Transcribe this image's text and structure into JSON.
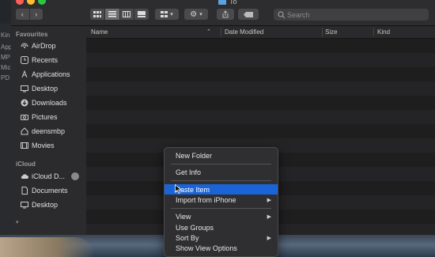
{
  "desktop": {
    "left_labels": [
      "Kin",
      "App",
      "MP",
      "Mic",
      "PD"
    ]
  },
  "window": {
    "title": "To",
    "search": {
      "placeholder": "Search"
    }
  },
  "sidebar": {
    "favourites_header": "Favourites",
    "favourites": [
      {
        "label": "AirDrop",
        "icon": "airdrop-icon"
      },
      {
        "label": "Recents",
        "icon": "clock-icon"
      },
      {
        "label": "Applications",
        "icon": "applications-icon"
      },
      {
        "label": "Desktop",
        "icon": "desktop-icon"
      },
      {
        "label": "Downloads",
        "icon": "download-icon"
      },
      {
        "label": "Pictures",
        "icon": "camera-icon"
      },
      {
        "label": "deensmbp",
        "icon": "home-icon"
      },
      {
        "label": "Movies",
        "icon": "film-icon"
      }
    ],
    "icloud_header": "iCloud",
    "icloud": [
      {
        "label": "iCloud D...",
        "icon": "cloud-icon"
      },
      {
        "label": "Documents",
        "icon": "document-icon"
      },
      {
        "label": "Desktop",
        "icon": "desktop-icon"
      }
    ]
  },
  "columns": {
    "name": "Name",
    "date_modified": "Date Modified",
    "size": "Size",
    "kind": "Kind"
  },
  "context_menu": {
    "items": [
      {
        "label": "New Folder",
        "submenu": false,
        "highlighted": false
      },
      {
        "label": "Get Info",
        "submenu": false,
        "highlighted": false
      },
      {
        "label": "Paste Item",
        "submenu": false,
        "highlighted": true
      },
      {
        "label": "Import from iPhone",
        "submenu": true,
        "highlighted": false
      },
      {
        "label": "View",
        "submenu": true,
        "highlighted": false
      },
      {
        "label": "Use Groups",
        "submenu": false,
        "highlighted": false
      },
      {
        "label": "Sort By",
        "submenu": true,
        "highlighted": false
      },
      {
        "label": "Show View Options",
        "submenu": false,
        "highlighted": false
      }
    ]
  },
  "colors": {
    "highlight": "#1a64d8",
    "window_bg": "#1e1e1e",
    "sidebar_bg": "#2b2b2d"
  }
}
